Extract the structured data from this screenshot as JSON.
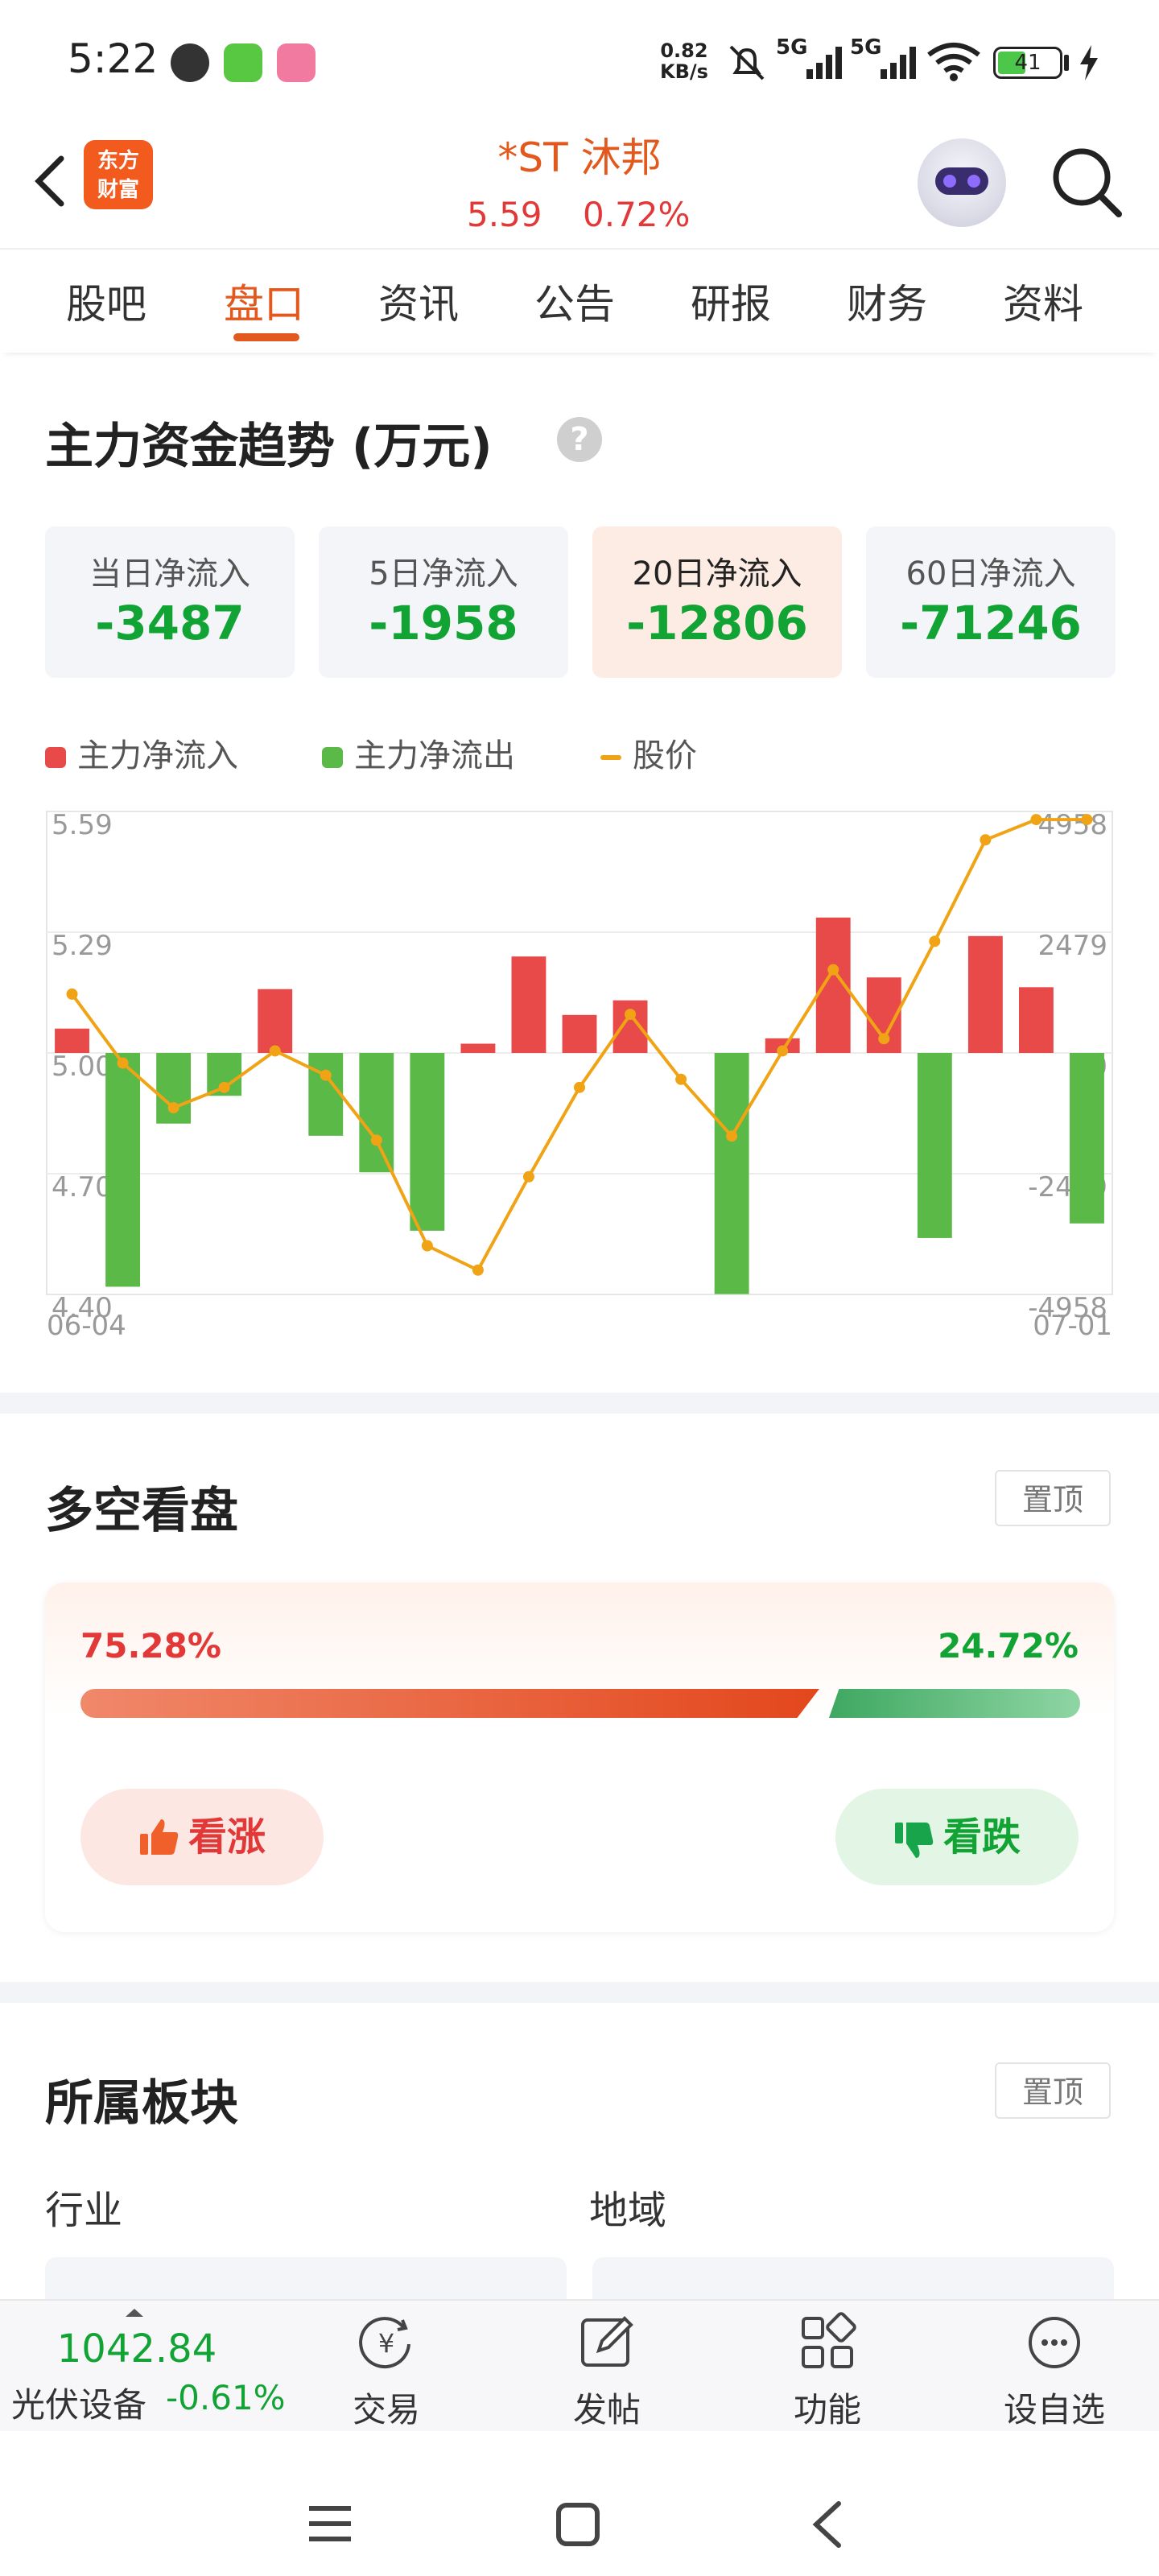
{
  "status_bar": {
    "time": "5:22",
    "net_speed_value": "0.82",
    "net_speed_unit": "KB/s",
    "signal1": "5G",
    "signal2": "5G",
    "battery": "41"
  },
  "header": {
    "logo_text": "东方财富",
    "stock_name": "*ST 沐邦",
    "price": "5.59",
    "change_pct": "0.72%"
  },
  "tabs": [
    "股吧",
    "盘口",
    "资讯",
    "公告",
    "研报",
    "财务",
    "资料"
  ],
  "active_tab": "盘口",
  "main_funds": {
    "title": "主力资金趋势 (万元)",
    "cards": [
      {
        "label": "当日净流入",
        "value": "-3487"
      },
      {
        "label": "5日净流入",
        "value": "-1958"
      },
      {
        "label": "20日净流入",
        "value": "-12806"
      },
      {
        "label": "60日净流入",
        "value": "-71246"
      }
    ],
    "selected_card": "20日净流入",
    "legend": [
      "主力净流入",
      "主力净流出",
      "股价"
    ]
  },
  "chart_data": {
    "type": "bar",
    "x_start_label": "06-04",
    "x_end_label": "07-01",
    "left_axis_ticks": [
      "5.59",
      "5.29",
      "5.00",
      "4.70",
      "4.40"
    ],
    "right_axis_ticks": [
      "4958",
      "2479",
      "0",
      "-2479",
      "-4958"
    ],
    "left_ylim": [
      4.4,
      5.59
    ],
    "right_ylim": [
      -4958,
      4958
    ],
    "series": [
      {
        "name": "主力净流入/净流出",
        "values": [
          500,
          -4800,
          -1450,
          -880,
          1310,
          -1700,
          -2450,
          -3650,
          190,
          1980,
          780,
          1080,
          0,
          -4950,
          300,
          2780,
          1550,
          -3800,
          2400,
          1350,
          -3500
        ]
      },
      {
        "name": "股价",
        "values": [
          5.14,
          4.97,
          4.86,
          4.91,
          5.0,
          4.94,
          4.78,
          4.52,
          4.46,
          4.69,
          4.91,
          5.09,
          4.93,
          4.79,
          5.0,
          5.2,
          5.03,
          5.27,
          5.52,
          5.57,
          5.57
        ]
      }
    ],
    "colors": {
      "inflow": "#e84a4a",
      "outflow": "#5bb947",
      "price": "#f0a314"
    }
  },
  "bull_bear": {
    "title": "多空看盘",
    "pin_label": "置顶",
    "bull_pct": "75.28%",
    "bear_pct": "24.72%",
    "bull_ratio": 0.7528,
    "bull_button": "看涨",
    "bear_button": "看跌"
  },
  "sector": {
    "title": "所属板块",
    "pin_label": "置顶",
    "industry_label": "行业",
    "region_label": "地域"
  },
  "bottom_nav": {
    "index_value": "1042.84",
    "index_name": "光伏设备",
    "index_change": "-0.61%",
    "items": [
      "交易",
      "发帖",
      "功能",
      "设自选"
    ]
  }
}
